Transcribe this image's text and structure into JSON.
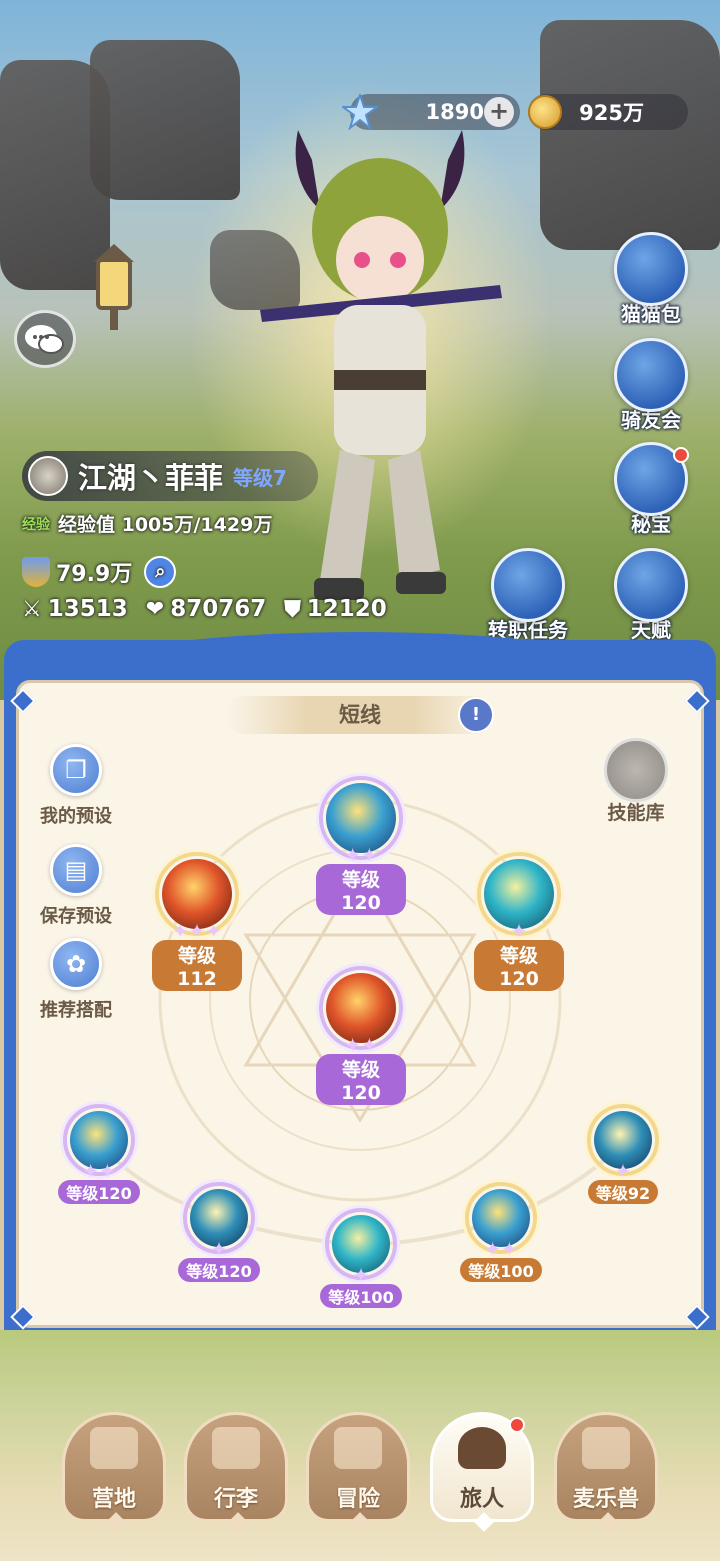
{
  "currency": {
    "gems": "1890",
    "gold": "925万",
    "add_label": "+"
  },
  "player": {
    "name": "江湖丶菲菲",
    "level": "等级7",
    "exp_tag": "经验",
    "exp_text": "经验值 1005万/1429万",
    "power": "79.9万",
    "attack": "13513",
    "hp": "870767",
    "defense": "12120"
  },
  "side_buttons": [
    {
      "label": "猫猫包",
      "icon": "cat-bag-icon"
    },
    {
      "label": "骑友会",
      "icon": "horse-icon"
    },
    {
      "label": "秘宝",
      "icon": "treasure-icon",
      "badge": true
    },
    {
      "label": "天赋",
      "icon": "talent-icon"
    },
    {
      "label": "转职任务",
      "icon": "class-change-icon"
    }
  ],
  "panel": {
    "tab_label": "短线",
    "tools": [
      {
        "label": "我的预设",
        "icon": "preset-icon"
      },
      {
        "label": "保存预设",
        "icon": "save-icon"
      },
      {
        "label": "推荐搭配",
        "icon": "recommend-icon"
      }
    ],
    "skill_library": "技能库",
    "skills": [
      {
        "level": "等级120",
        "stars": "✦✦",
        "tier": "purple"
      },
      {
        "level": "等级112",
        "stars": "✦✦✦",
        "tier": "orange"
      },
      {
        "level": "等级120",
        "stars": "✦",
        "tier": "orange"
      },
      {
        "level": "等级120",
        "stars": "✦✦",
        "tier": "purple"
      },
      {
        "level": "等级120",
        "stars": "✦✦",
        "tier": "purple"
      },
      {
        "level": "等级92",
        "stars": "✦",
        "tier": "orange"
      },
      {
        "level": "等级120",
        "stars": "✦",
        "tier": "purple"
      },
      {
        "level": "等级100",
        "stars": "✦",
        "tier": "purple"
      },
      {
        "level": "等级100",
        "stars": "✦✦",
        "tier": "orange"
      }
    ]
  },
  "nav": [
    {
      "label": "营地",
      "icon": "camp-icon"
    },
    {
      "label": "行李",
      "icon": "luggage-icon"
    },
    {
      "label": "冒险",
      "icon": "swords-icon"
    },
    {
      "label": "旅人",
      "icon": "traveler-icon",
      "active": true,
      "badge": true
    },
    {
      "label": "麦乐兽",
      "icon": "pet-icon"
    }
  ]
}
